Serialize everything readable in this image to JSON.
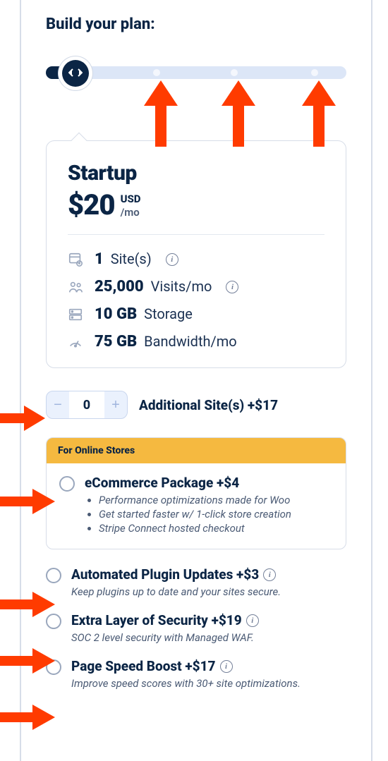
{
  "heading": "Build your plan:",
  "plan": {
    "name": "Startup",
    "price": "$20",
    "currency": "USD",
    "period": "/mo",
    "features": [
      {
        "value": "1",
        "label": "Site(s)",
        "info": true
      },
      {
        "value": "25,000",
        "label": "Visits/mo",
        "info": true
      },
      {
        "value": "10 GB",
        "label": "Storage",
        "info": false
      },
      {
        "value": "75 GB",
        "label": "Bandwidth/mo",
        "info": false
      }
    ]
  },
  "additional_sites": {
    "value": "0",
    "label": "Additional Site(s) +$17"
  },
  "ecommerce": {
    "banner": "For Online Stores",
    "title": "eCommerce Package +$4",
    "bullets": [
      "Performance optimizations made for Woo",
      "Get started faster w/ 1-click store creation",
      "Stripe Connect hosted checkout"
    ]
  },
  "addons": [
    {
      "title": "Automated Plugin Updates +$3",
      "desc": "Keep plugins up to date and your sites secure.",
      "info": true
    },
    {
      "title": "Extra Layer of Security +$19",
      "desc": "SOC 2 level security with Managed WAF.",
      "info": true
    },
    {
      "title": "Page Speed Boost +$17",
      "desc": "Improve speed scores with 30+ site optimizations.",
      "info": true
    }
  ]
}
